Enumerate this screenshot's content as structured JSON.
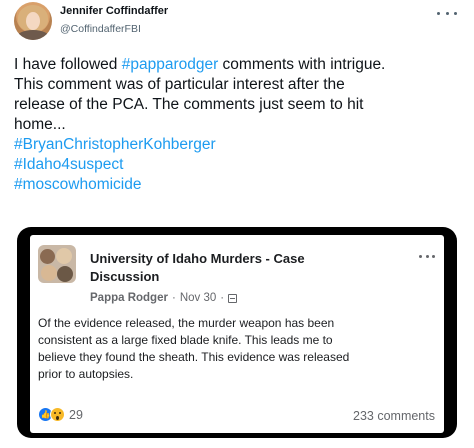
{
  "author": {
    "name": "Jennifer Coffindaffer",
    "handle": "@CoffindafferFBI"
  },
  "tweet": {
    "text_lines": [
      {
        "before": "I have followed ",
        "hashtag": "#papparodger",
        "after": " comments with intrigue."
      },
      {
        "before": "This comment was of particular interest after the",
        "hashtag": "",
        "after": ""
      },
      {
        "before": "release of the PCA. The comments just seem to hit",
        "hashtag": "",
        "after": ""
      },
      {
        "before": "home...",
        "hashtag": "",
        "after": ""
      }
    ],
    "hashtags": [
      "#BryanChristopherKohberger",
      "#Idaho4suspect",
      "#moscowhomicide"
    ]
  },
  "embedded_post": {
    "group_title_line1": "University of Idaho Murders - Case",
    "group_title_line2": "Discussion",
    "author": "Pappa Rodger",
    "separator": "·",
    "date": "Nov 30",
    "separator2": "·",
    "text_lines": [
      "Of the evidence released, the murder weapon has been",
      "consistent as a large fixed blade knife.  This leads me to",
      "believe they found the sheath.  This evidence was released",
      "prior to autopsies."
    ],
    "reaction_count": "29",
    "comments": "233 comments"
  },
  "icons": {
    "more": "more-horizontal-icon",
    "like": "like-reaction-icon",
    "wow": "wow-reaction-icon",
    "privacy": "group-privacy-icon"
  },
  "colors": {
    "hashtag": "#1d9bf0",
    "fb_like": "#1877f2",
    "fb_wow": "#f7b928"
  }
}
